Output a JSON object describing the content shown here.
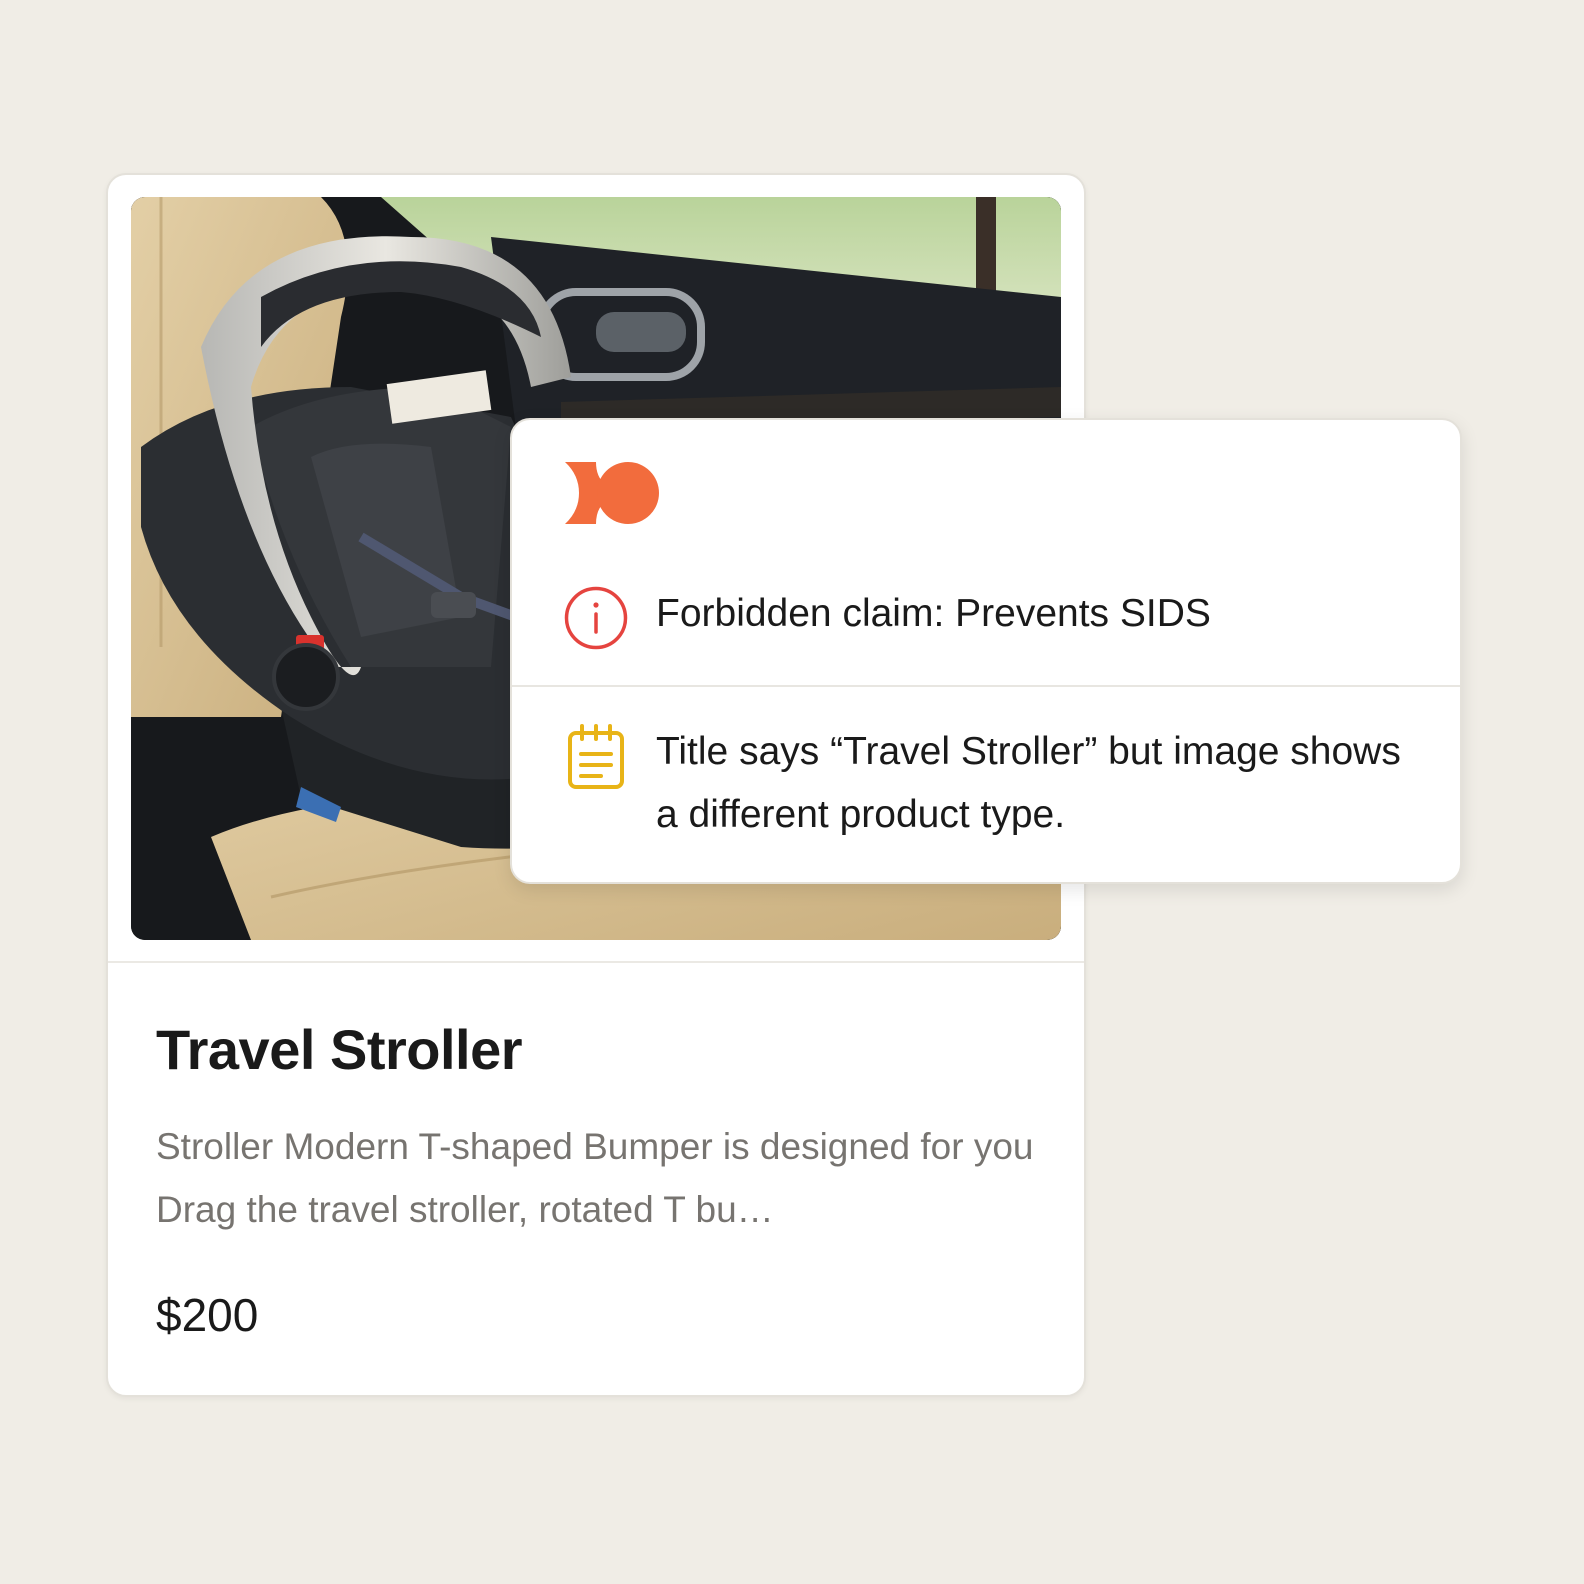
{
  "product": {
    "title": "Travel Stroller",
    "description": "Stroller Modern T-shaped Bumper is designed for you Drag the travel stroller, rotated T bu…",
    "price": "$200",
    "image_subject": "infant car seat installed on a vehicle back seat"
  },
  "review": {
    "logo_icon": "brand-logo-icon",
    "issues": [
      {
        "icon": "info-circle-icon",
        "color": "#e5443f",
        "text": "Forbidden claim: Prevents SIDS"
      },
      {
        "icon": "notepad-icon",
        "color": "#e8b417",
        "text": "Title says “Travel Stroller” but image shows a different product type."
      }
    ]
  },
  "colors": {
    "background": "#f0ede6",
    "brand_orange": "#f26c3d",
    "error_red": "#e5443f",
    "warning_yellow": "#e8b417"
  }
}
